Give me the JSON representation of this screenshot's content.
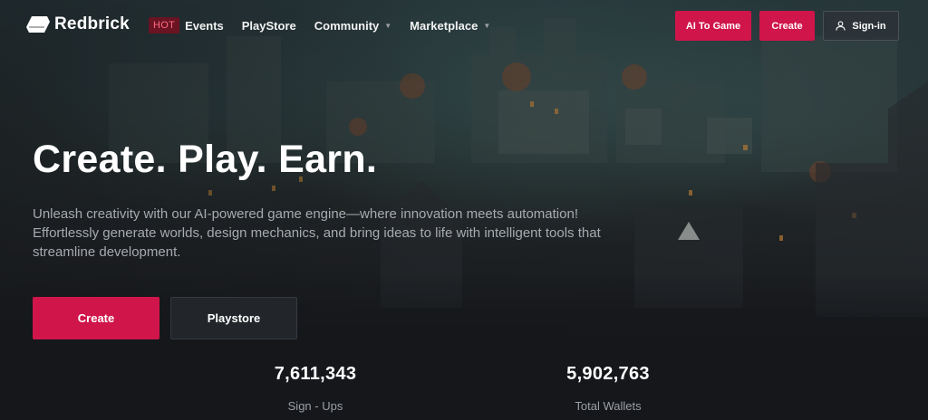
{
  "brand": {
    "name": "Redbrick",
    "logo_icon": "redbrick-logo-icon"
  },
  "nav": {
    "items": [
      {
        "label": "Events",
        "badge": "HOT",
        "dropdown": false
      },
      {
        "label": "PlayStore",
        "dropdown": false
      },
      {
        "label": "Community",
        "dropdown": true
      },
      {
        "label": "Marketplace",
        "dropdown": true
      }
    ],
    "dropdown_icon": "chevron-down-icon",
    "actions": {
      "ai_to_game": "AI To Game",
      "create": "Create",
      "sign_in": "Sign-in",
      "sign_in_icon": "user-icon"
    }
  },
  "hero": {
    "title": "Create. Play. Earn.",
    "description": "Unleash creativity with our AI-powered game engine—where innovation meets automation! Effortlessly generate worlds, design mechanics, and bring ideas to life with intelligent tools that streamline development.",
    "buttons": {
      "create": "Create",
      "playstore": "Playstore"
    }
  },
  "stats": [
    {
      "value": "7,611,343",
      "label": "Sign - Ups"
    },
    {
      "value": "5,902,763",
      "label": "Total Wallets"
    }
  ],
  "colors": {
    "accent": "#d0154a",
    "hot_badge_bg": "#6a1322",
    "page_bg": "#15171b"
  }
}
